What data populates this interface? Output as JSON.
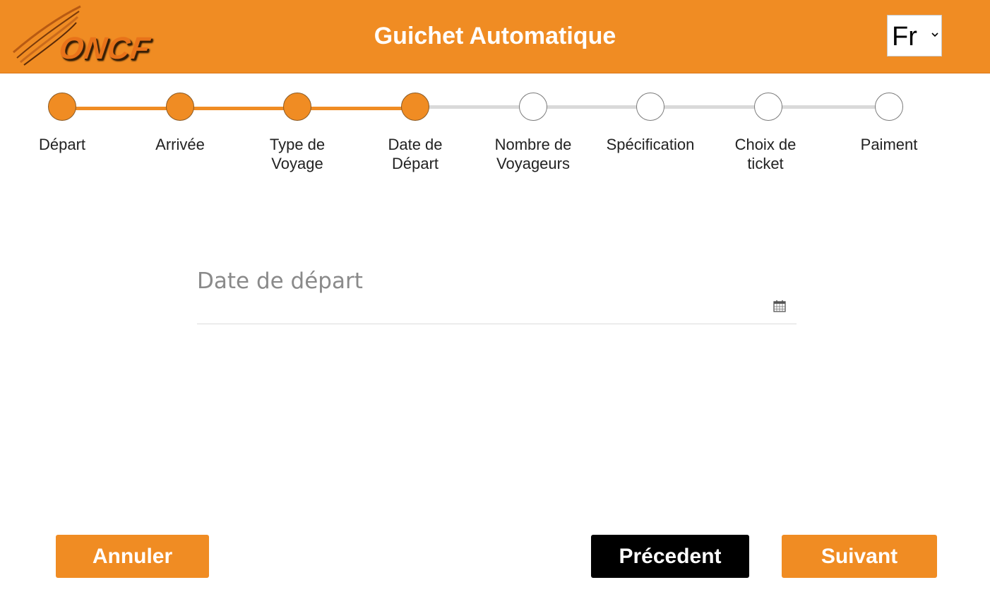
{
  "header": {
    "logo_text": "ONCF",
    "title": "Guichet Automatique",
    "language": {
      "selected": "Fr"
    }
  },
  "steps": [
    {
      "label": "Départ",
      "status": "done"
    },
    {
      "label": "Arrivée",
      "status": "done"
    },
    {
      "label": "Type de Voyage",
      "status": "done"
    },
    {
      "label": "Date de Départ",
      "status": "current"
    },
    {
      "label": "Nombre de Voyageurs",
      "status": "todo"
    },
    {
      "label": "Spécification",
      "status": "todo"
    },
    {
      "label": "Choix de ticket",
      "status": "todo"
    },
    {
      "label": "Paiment",
      "status": "todo"
    }
  ],
  "form": {
    "date_placeholder": "Date de départ",
    "date_value": ""
  },
  "buttons": {
    "cancel": "Annuler",
    "previous": "Précedent",
    "next": "Suivant"
  },
  "colors": {
    "accent": "#f08c23",
    "inactive_line": "#d9d9d9",
    "previous_button": "#000000"
  },
  "icons": {
    "calendar": "calendar-icon",
    "chevron": "chevron-down-icon"
  }
}
